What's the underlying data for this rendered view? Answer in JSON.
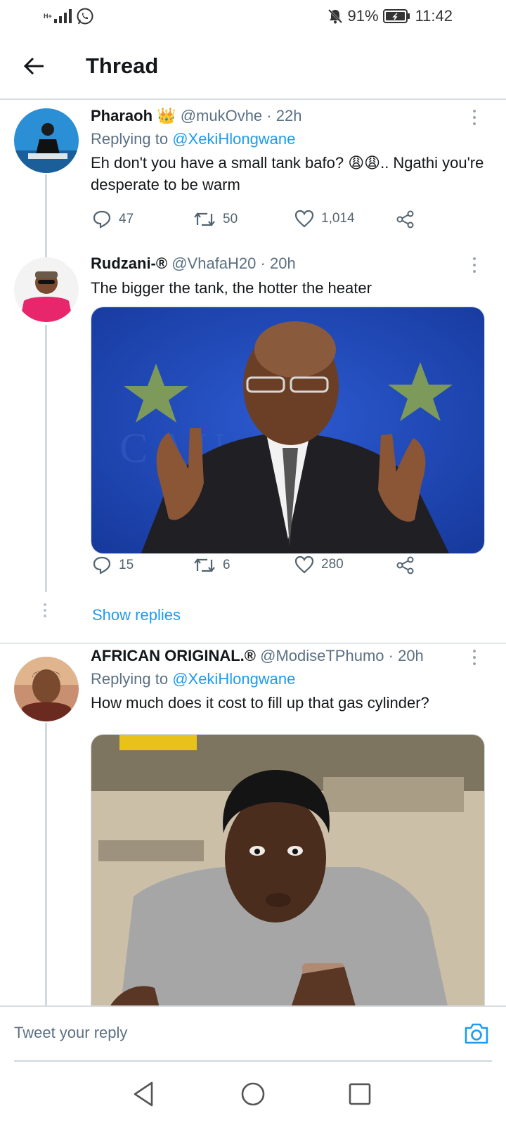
{
  "status_bar": {
    "network": "H+",
    "battery": "91%",
    "time": "11:42"
  },
  "header": {
    "title": "Thread"
  },
  "tweets": [
    {
      "name": "Pharaoh",
      "name_emoji": "👑",
      "handle": "@mukOvhe",
      "time": "· 22h",
      "replying_prefix": "Replying to ",
      "replying_to": "@XekiHlongwane",
      "text": "Eh don't you have a small tank bafo? 😩😩.. Ngathi you're desperate to be warm",
      "replies": "47",
      "retweets": "50",
      "likes": "1,014"
    },
    {
      "name": "Rudzani-®",
      "handle": "@VhafaH20",
      "time": "· 20h",
      "text": "The bigger the tank, the hotter the heater",
      "replies": "15",
      "retweets": "6",
      "likes": "280",
      "show_replies": "Show replies"
    },
    {
      "name": "AFRICAN ORIGINAL.®",
      "handle": "@ModiseTPhumo",
      "time": "· 20h",
      "replying_prefix": "Replying to ",
      "replying_to": "@XekiHlongwane",
      "text": "How much does it cost to fill up that gas cylinder?"
    }
  ],
  "compose": {
    "placeholder": "Tweet your reply"
  },
  "colors": {
    "link": "#1d9bf0",
    "muted": "#5b7083",
    "text": "#14171a"
  }
}
